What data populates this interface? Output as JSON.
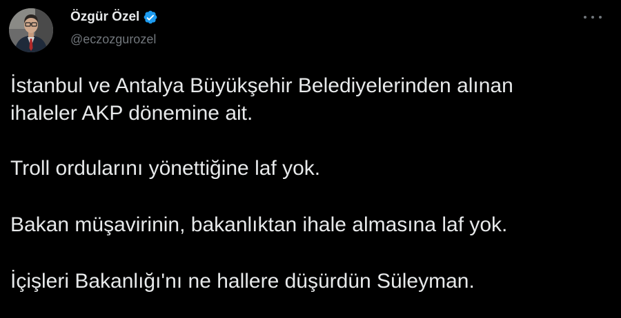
{
  "author": {
    "display_name": "Özgür Özel",
    "handle": "@eczozgurozel",
    "verified": true,
    "avatar_icon": "profile-photo",
    "verified_icon": "verified-badge-icon",
    "verified_color": "#1d9bf0"
  },
  "menu": {
    "icon": "more-options-icon"
  },
  "tweet": {
    "line1": "İstanbul ve Antalya Büyükşehir Belediyelerinden alınan",
    "line2": "ihaleler AKP dönemine ait.",
    "line3": "Troll ordularını yönettiğine laf yok.",
    "line4": "Bakan müşavirinin, bakanlıktan ihale almasına laf yok.",
    "line5": "İçişleri Bakanlığı'nı ne hallere düşürdün Süleyman."
  },
  "colors": {
    "background": "#000000",
    "text_primary": "#e7e9ea",
    "text_secondary": "#71767b"
  }
}
